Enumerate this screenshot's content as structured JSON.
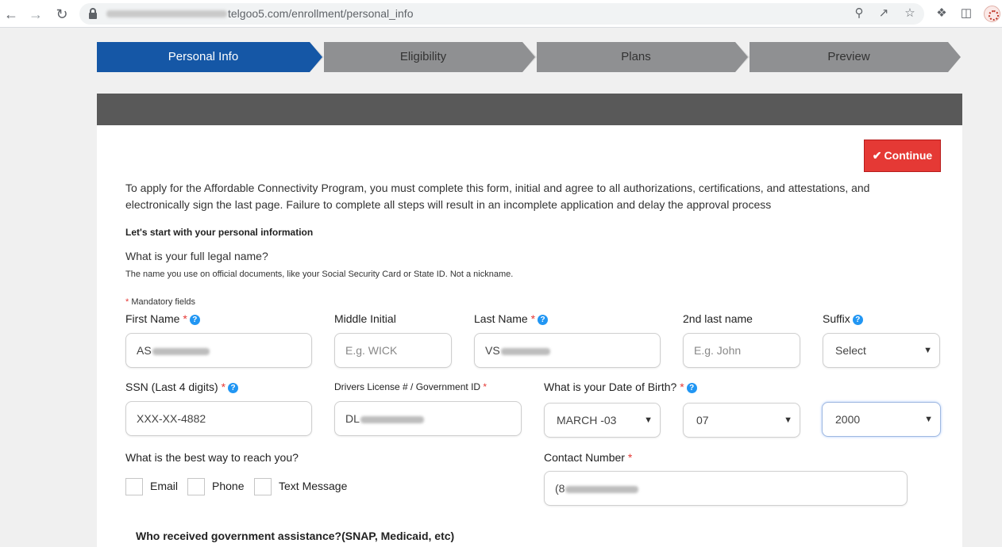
{
  "browser": {
    "url_visible": "telgoo5.com/enrollment/personal_info",
    "icons": [
      "back-arrow-icon",
      "forward-arrow-icon",
      "reload-icon",
      "lock-icon",
      "zoom-icon",
      "share-icon",
      "star-icon",
      "extensions-icon",
      "side-panel-icon",
      "profile-avatar"
    ]
  },
  "steps": [
    {
      "label": "Personal Info",
      "active": true
    },
    {
      "label": "Eligibility",
      "active": false
    },
    {
      "label": "Plans",
      "active": false
    },
    {
      "label": "Preview",
      "active": false
    }
  ],
  "colors": {
    "active_step": "#1557a6",
    "inactive_step": "#8f9092",
    "continue": "#e53935",
    "help": "#2196f3",
    "header_bar": "#595959"
  },
  "form": {
    "continue_label": "Continue",
    "intro": "To apply for the Affordable Connectivity Program, you must complete this form, initial and agree to all authorizations, certifications, and attestations, and electronically sign the last page. Failure to complete all steps will result in an incomplete application and delay the approval process",
    "section_title": "Let's start with your personal information",
    "name_question": "What is your full legal name?",
    "name_hint": "The name you use on official documents, like your Social Security Card or State ID. Not a nickname.",
    "mandatory_note": "Mandatory fields",
    "first_name": {
      "label": "First Name",
      "value_prefix": "AS"
    },
    "middle_initial": {
      "label": "Middle Initial",
      "placeholder": "E.g. WICK"
    },
    "last_name": {
      "label": "Last Name",
      "value_prefix": "VS"
    },
    "second_last_name": {
      "label": "2nd last name",
      "placeholder": "E.g. John"
    },
    "suffix": {
      "label": "Suffix",
      "selected": "Select"
    },
    "ssn": {
      "label": "SSN (Last 4 digits)",
      "value": "XXX-XX-4882"
    },
    "drivers_license": {
      "label": "Drivers License # / Government ID",
      "value_prefix": "DL"
    },
    "dob": {
      "label": "What is your Date of Birth?",
      "month": "MARCH -03",
      "day": "07",
      "year": "2000"
    },
    "contact_question": "What is the best way to reach you?",
    "contact_options": [
      "Email",
      "Phone",
      "Text Message"
    ],
    "contact_number": {
      "label": "Contact Number",
      "value_prefix": "(8"
    },
    "assistance_question": "Who received government assistance?(SNAP, Medicaid, etc)"
  }
}
